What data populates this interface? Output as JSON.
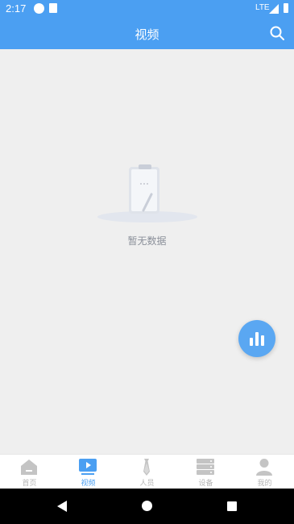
{
  "status_bar": {
    "time": "2:17",
    "network": "LTE",
    "icons": [
      "notification-icon",
      "sd-card-icon",
      "signal-icon",
      "battery-icon"
    ]
  },
  "header": {
    "title": "视频",
    "search_icon": "search-icon"
  },
  "empty_state": {
    "text": "暂无数据",
    "icon": "clipboard-icon"
  },
  "fab": {
    "icon": "bar-chart-icon"
  },
  "tabs": [
    {
      "label": "首页",
      "icon": "home-icon",
      "active": false
    },
    {
      "label": "视频",
      "icon": "video-icon",
      "active": true
    },
    {
      "label": "人员",
      "icon": "person-tie-icon",
      "active": false
    },
    {
      "label": "设备",
      "icon": "server-icon",
      "active": false
    },
    {
      "label": "我的",
      "icon": "user-icon",
      "active": false
    }
  ],
  "colors": {
    "primary": "#4b9ff2",
    "background": "#efefef",
    "tab_inactive": "#b6b6b6"
  }
}
